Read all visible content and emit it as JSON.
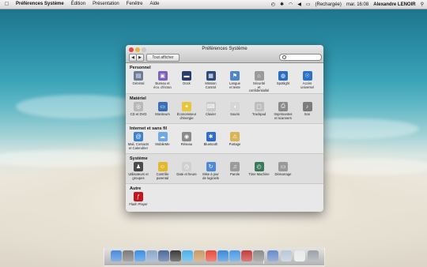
{
  "menubar": {
    "apple_icon": "apple-icon",
    "items": [
      "Préférences Système",
      "Édition",
      "Présentation",
      "Fenêtre",
      "Aide"
    ],
    "battery": "(Rechargée)",
    "clock": "mar. 16:08",
    "user": "Alexandre LENOIR"
  },
  "window": {
    "title": "Préférences Système",
    "show_all_label": "Tout afficher",
    "search_placeholder": ""
  },
  "sections": [
    {
      "title": "Personnel",
      "items": [
        {
          "label": "Général",
          "icon": "general-icon",
          "color": "#6b7d96",
          "glyph": "▤"
        },
        {
          "label": "Bureau et\néco. d'écran",
          "icon": "desktop-screensaver-icon",
          "color": "#7a62b8",
          "glyph": "▣"
        },
        {
          "label": "Dock",
          "icon": "dock-icon",
          "color": "#2a3c6a",
          "glyph": "▬"
        },
        {
          "label": "Mission\nControl",
          "icon": "mission-control-icon",
          "color": "#2c4a7c",
          "glyph": "▦"
        },
        {
          "label": "Langue\net texte",
          "icon": "language-text-icon",
          "color": "#4f86c6",
          "glyph": "⚑"
        },
        {
          "label": "Sécurité\net confidentialité",
          "icon": "security-icon",
          "color": "#9a9a9a",
          "glyph": "⌂"
        },
        {
          "label": "Spotlight",
          "icon": "spotlight-icon",
          "color": "#2b6dc0",
          "glyph": "◍"
        },
        {
          "label": "Accès\nuniversel",
          "icon": "accessibility-icon",
          "color": "#2b73c8",
          "glyph": "☉"
        }
      ]
    },
    {
      "title": "Matériel",
      "items": [
        {
          "label": "CD et DVD",
          "icon": "cd-dvd-icon",
          "color": "#b8b8b8",
          "glyph": "◎"
        },
        {
          "label": "Moniteurs",
          "icon": "displays-icon",
          "color": "#3a6fb6",
          "glyph": "▭"
        },
        {
          "label": "Économiseur\nd'énergie",
          "icon": "energy-saver-icon",
          "color": "#e8c53a",
          "glyph": "✦"
        },
        {
          "label": "Clavier",
          "icon": "keyboard-icon",
          "color": "#c9c9c9",
          "glyph": "⌨"
        },
        {
          "label": "Souris",
          "icon": "mouse-icon",
          "color": "#d6d6d6",
          "glyph": "◖"
        },
        {
          "label": "Trackpad",
          "icon": "trackpad-icon",
          "color": "#bdbdbd",
          "glyph": "▢"
        },
        {
          "label": "Imprimantes\net scanners",
          "icon": "printer-icon",
          "color": "#8a8a8a",
          "glyph": "⎙"
        },
        {
          "label": "Son",
          "icon": "sound-icon",
          "color": "#7c7c7c",
          "glyph": "♪"
        }
      ]
    },
    {
      "title": "Internet et sans fil",
      "items": [
        {
          "label": "Mail, Contacts\net Calendrier",
          "icon": "mail-contacts-icon",
          "color": "#3b82d4",
          "glyph": "@"
        },
        {
          "label": "MobileMe",
          "icon": "mobileme-icon",
          "color": "#6ea9e6",
          "glyph": "☁"
        },
        {
          "label": "Réseau",
          "icon": "network-icon",
          "color": "#8a8a8a",
          "glyph": "◉"
        },
        {
          "label": "Bluetooth",
          "icon": "bluetooth-icon",
          "color": "#2f6ccf",
          "glyph": "✱"
        },
        {
          "label": "Partage",
          "icon": "sharing-icon",
          "color": "#d9b454",
          "glyph": "⚠"
        }
      ]
    },
    {
      "title": "Système",
      "items": [
        {
          "label": "Utilisateurs et\ngroupes",
          "icon": "users-groups-icon",
          "color": "#4a4a4a",
          "glyph": "♟"
        },
        {
          "label": "Contrôle\nparental",
          "icon": "parental-controls-icon",
          "color": "#e2b92d",
          "glyph": "☺"
        },
        {
          "label": "Date et heure",
          "icon": "date-time-icon",
          "color": "#d0d0d0",
          "glyph": "◷"
        },
        {
          "label": "Mise à jour\nde logiciels",
          "icon": "software-update-icon",
          "color": "#4f8ad6",
          "glyph": "↻"
        },
        {
          "label": "Parole",
          "icon": "speech-icon",
          "color": "#9c9c9c",
          "glyph": "♫"
        },
        {
          "label": "Time Machine",
          "icon": "time-machine-icon",
          "color": "#3a7a5a",
          "glyph": "◴"
        },
        {
          "label": "Démarrage",
          "icon": "startup-disk-icon",
          "color": "#9a9a9a",
          "glyph": "▭"
        }
      ]
    },
    {
      "title": "Autre",
      "items": [
        {
          "label": "Flash Player",
          "icon": "flash-player-icon",
          "color": "#c4161c",
          "glyph": "ƒ"
        }
      ]
    }
  ],
  "dock": [
    {
      "icon": "finder-icon",
      "color": "#4a8ad8"
    },
    {
      "icon": "launchpad-icon",
      "color": "#7a7a7a"
    },
    {
      "icon": "safari-icon",
      "color": "#3a8ee0"
    },
    {
      "icon": "mail-icon",
      "color": "#8aa6c8"
    },
    {
      "icon": "photo-icon",
      "color": "#4a6a9a"
    },
    {
      "icon": "facetime-icon",
      "color": "#3a3a3a"
    },
    {
      "icon": "ical-icon",
      "color": "#4ab0e8"
    },
    {
      "icon": "address-book-icon",
      "color": "#c89a62"
    },
    {
      "icon": "calendar-icon",
      "color": "#e84a3a"
    },
    {
      "icon": "itunes-icon",
      "color": "#3a8ad8"
    },
    {
      "icon": "app-store-icon",
      "color": "#4a9ae0"
    },
    {
      "icon": "photo-booth-icon",
      "color": "#c83a3a"
    },
    {
      "icon": "system-preferences-icon",
      "color": "#8a8a8a"
    },
    {
      "icon": "applications-folder-icon",
      "color": "#6a8ac8"
    },
    {
      "icon": "documents-folder-icon",
      "color": "#b8c8d8"
    },
    {
      "icon": "document-icon",
      "color": "#e8e8e8"
    },
    {
      "icon": "trash-icon",
      "color": "#9aa2a8"
    }
  ]
}
